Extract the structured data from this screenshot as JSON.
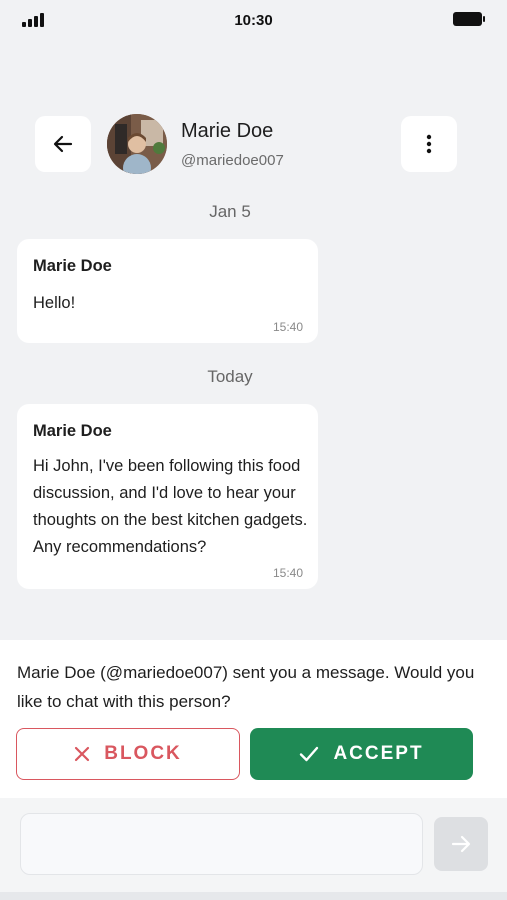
{
  "status_bar": {
    "time": "10:30"
  },
  "header": {
    "contact_name": "Marie Doe",
    "contact_handle": "@mariedoe007",
    "icons": {
      "back": "arrow-left-icon",
      "more": "more-vertical-icon"
    }
  },
  "conversation": {
    "groups": [
      {
        "date": "Jan 5",
        "messages": [
          {
            "sender": "Marie Doe",
            "text": "Hello!",
            "time": "15:40"
          }
        ]
      },
      {
        "date": "Today",
        "messages": [
          {
            "sender": "Marie Doe",
            "text": "Hi John, I've been following this food discussion, and I'd love to hear your thoughts on the best kitchen gadgets. Any recommendations?",
            "time": "15:40"
          }
        ]
      }
    ]
  },
  "request": {
    "name": "Marie Doe",
    "message": " (@mariedoe007) sent you a message. Would you like to chat with this person?",
    "block_label": "BLOCK",
    "accept_label": "ACCEPT"
  },
  "composer": {
    "placeholder": "",
    "send_icon": "arrow-right-icon"
  },
  "colors": {
    "background": "#F1F2F4",
    "accept": "#1F8A55",
    "block": "#D9575F"
  }
}
